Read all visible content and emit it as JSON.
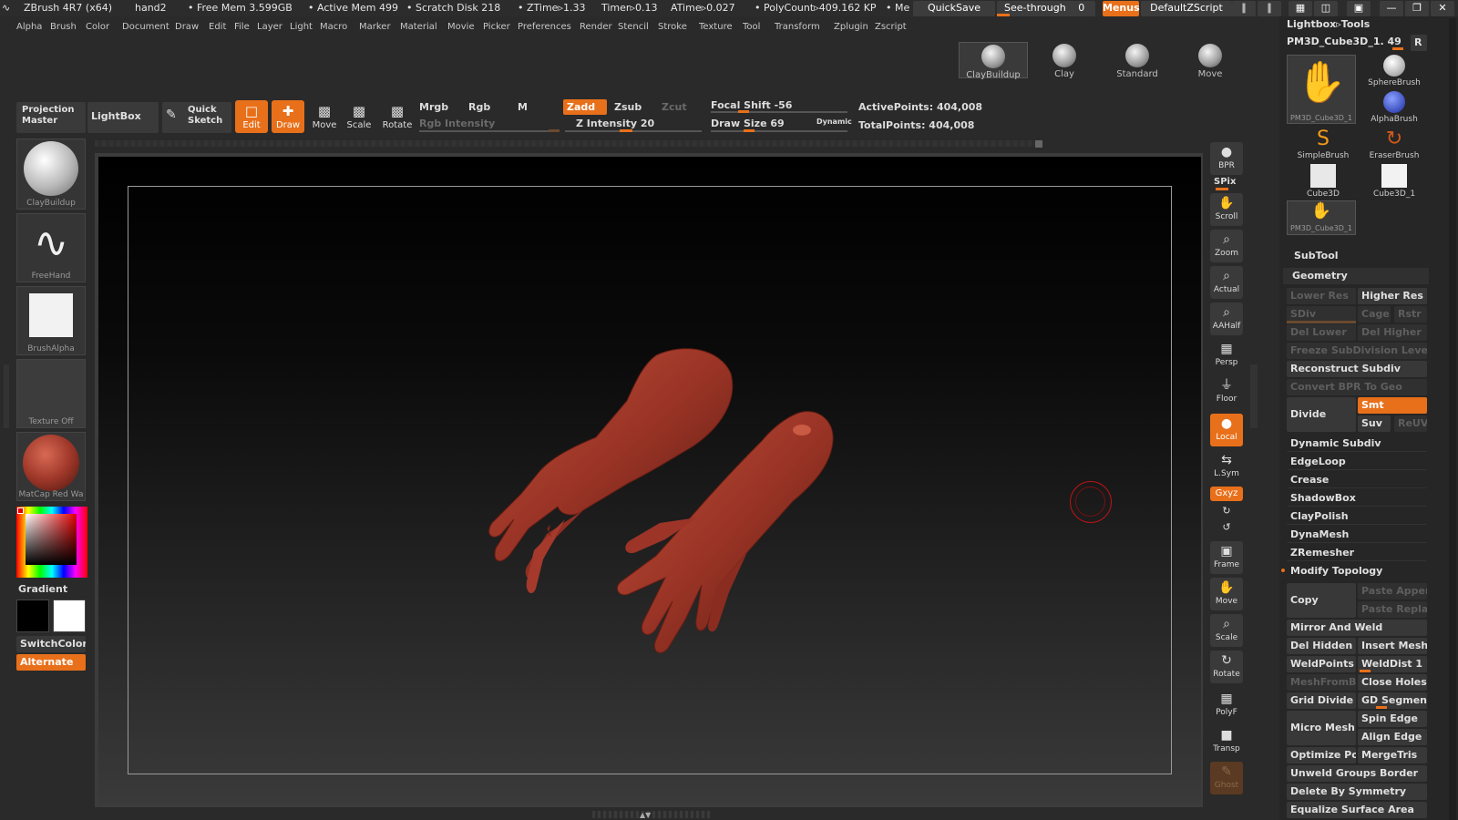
{
  "titlebar": {
    "app": "ZBrush 4R7 (x64)",
    "doc": "hand2",
    "freemem": "• Free Mem 3.599GB",
    "activemem": "• Active Mem 499",
    "scratch": "• Scratch Disk 218",
    "ztime": "• ZTime▹1.33",
    "timer": "Timer▹0.13",
    "atime": "ATime▹0.027",
    "polycount": "• PolyCount▹409.162 KP",
    "me": "• Me",
    "quicksave": "QuickSave",
    "seethrough": "See-through",
    "seethrough_value": "0",
    "menus": "Menus",
    "defaultzscript": "DefaultZScript"
  },
  "menubar": [
    "Alpha",
    "Brush",
    "Color",
    "Document",
    "Draw",
    "Edit",
    "File",
    "Layer",
    "Light",
    "Macro",
    "Marker",
    "Material",
    "Movie",
    "Picker",
    "Preferences",
    "Render",
    "Stencil",
    "Stroke",
    "Texture",
    "Tool",
    "Transform",
    "Zplugin",
    "Zscript"
  ],
  "shelf_brushes": [
    "ClayBuildup",
    "Clay",
    "Standard",
    "Move"
  ],
  "shelf": {
    "projection_master": "Projection Master",
    "lightbox": "LightBox",
    "quick_sketch": "Quick Sketch",
    "edit": "Edit",
    "draw": "Draw",
    "move": "Move",
    "scale": "Scale",
    "rotate": "Rotate",
    "mrgb": "Mrgb",
    "rgb": "Rgb",
    "m": "M",
    "rgb_intensity": "Rgb Intensity",
    "zadd": "Zadd",
    "zsub": "Zsub",
    "zcut": "Zcut",
    "z_intensity": "Z Intensity 20",
    "focal_shift": "Focal Shift -56",
    "draw_size": "Draw Size 69",
    "dynamic": "Dynamic",
    "active_points": "ActivePoints: 404,008",
    "total_points": "TotalPoints: 404,008"
  },
  "left_tray": {
    "brush": "ClayBuildup",
    "stroke": "FreeHand",
    "alpha": "BrushAlpha",
    "texture": "Texture Off",
    "material": "MatCap Red Wa",
    "gradient": "Gradient",
    "switchcolor": "SwitchColor",
    "alternate": "Alternate"
  },
  "right_tools": [
    "BPR",
    "SPix",
    "Scroll",
    "Zoom",
    "Actual",
    "AAHalf",
    "Persp",
    "Floor",
    "Local",
    "L.Sym",
    "Gxyz",
    "Frame",
    "Move",
    "Scale",
    "Rotate",
    "PolyF",
    "Transp",
    "Ghost"
  ],
  "right_panel": {
    "header": "Lightbox▹Tools",
    "current_tool": "PM3D_Cube3D_1. 49",
    "r_button": "R",
    "tools": [
      "SphereBrush",
      "AlphaBrush",
      "SimpleBrush",
      "EraserBrush",
      "Cube3D",
      "Cube3D_1",
      "PM3D_Cube3D_1",
      "PM3D_Cube3D_1"
    ],
    "subtool": "SubTool",
    "geometry": "Geometry",
    "lower_res": "Lower Res",
    "higher_res": "Higher Res",
    "sdiv": "SDiv",
    "cage": "Cage",
    "rstr": "Rstr",
    "del_lower": "Del Lower",
    "del_higher": "Del Higher",
    "freeze": "Freeze SubDivision Levels",
    "reconstruct": "Reconstruct Subdiv",
    "convert_bpr": "Convert BPR To Geo",
    "divide": "Divide",
    "smt": "Smt",
    "suv": "Suv",
    "reuv": "ReUV",
    "dynamic_subdiv": "Dynamic Subdiv",
    "edgeloop": "EdgeLoop",
    "crease": "Crease",
    "shadowbox": "ShadowBox",
    "claypolish": "ClayPolish",
    "dynamesh": "DynaMesh",
    "zremesher": "ZRemesher",
    "modify_topology": "Modify Topology",
    "copy": "Copy",
    "paste_append": "Paste Appen",
    "paste_replace": "Paste Replac",
    "mirror_weld": "Mirror And Weld",
    "del_hidden": "Del Hidden",
    "insert_mesh": "Insert Mesh",
    "weldpoints": "WeldPoints",
    "welddist": "WeldDist 1",
    "meshfrombrush": "MeshFromBr",
    "close_holes": "Close Holes",
    "grid_divide": "Grid Divide",
    "gd_segments": "GD Segment",
    "micro_mesh": "Micro Mesh",
    "spin_edge": "Spin Edge",
    "align_edge": "Align Edge",
    "optimize_points": "Optimize Poi",
    "mergetris": "MergeTris",
    "unweld_groups": "Unweld Groups Border",
    "delete_symmetry": "Delete By Symmetry",
    "equalize": "Equalize Surface Area"
  },
  "colors": {
    "accent": "#e8701a",
    "clay": "#a0382a"
  }
}
